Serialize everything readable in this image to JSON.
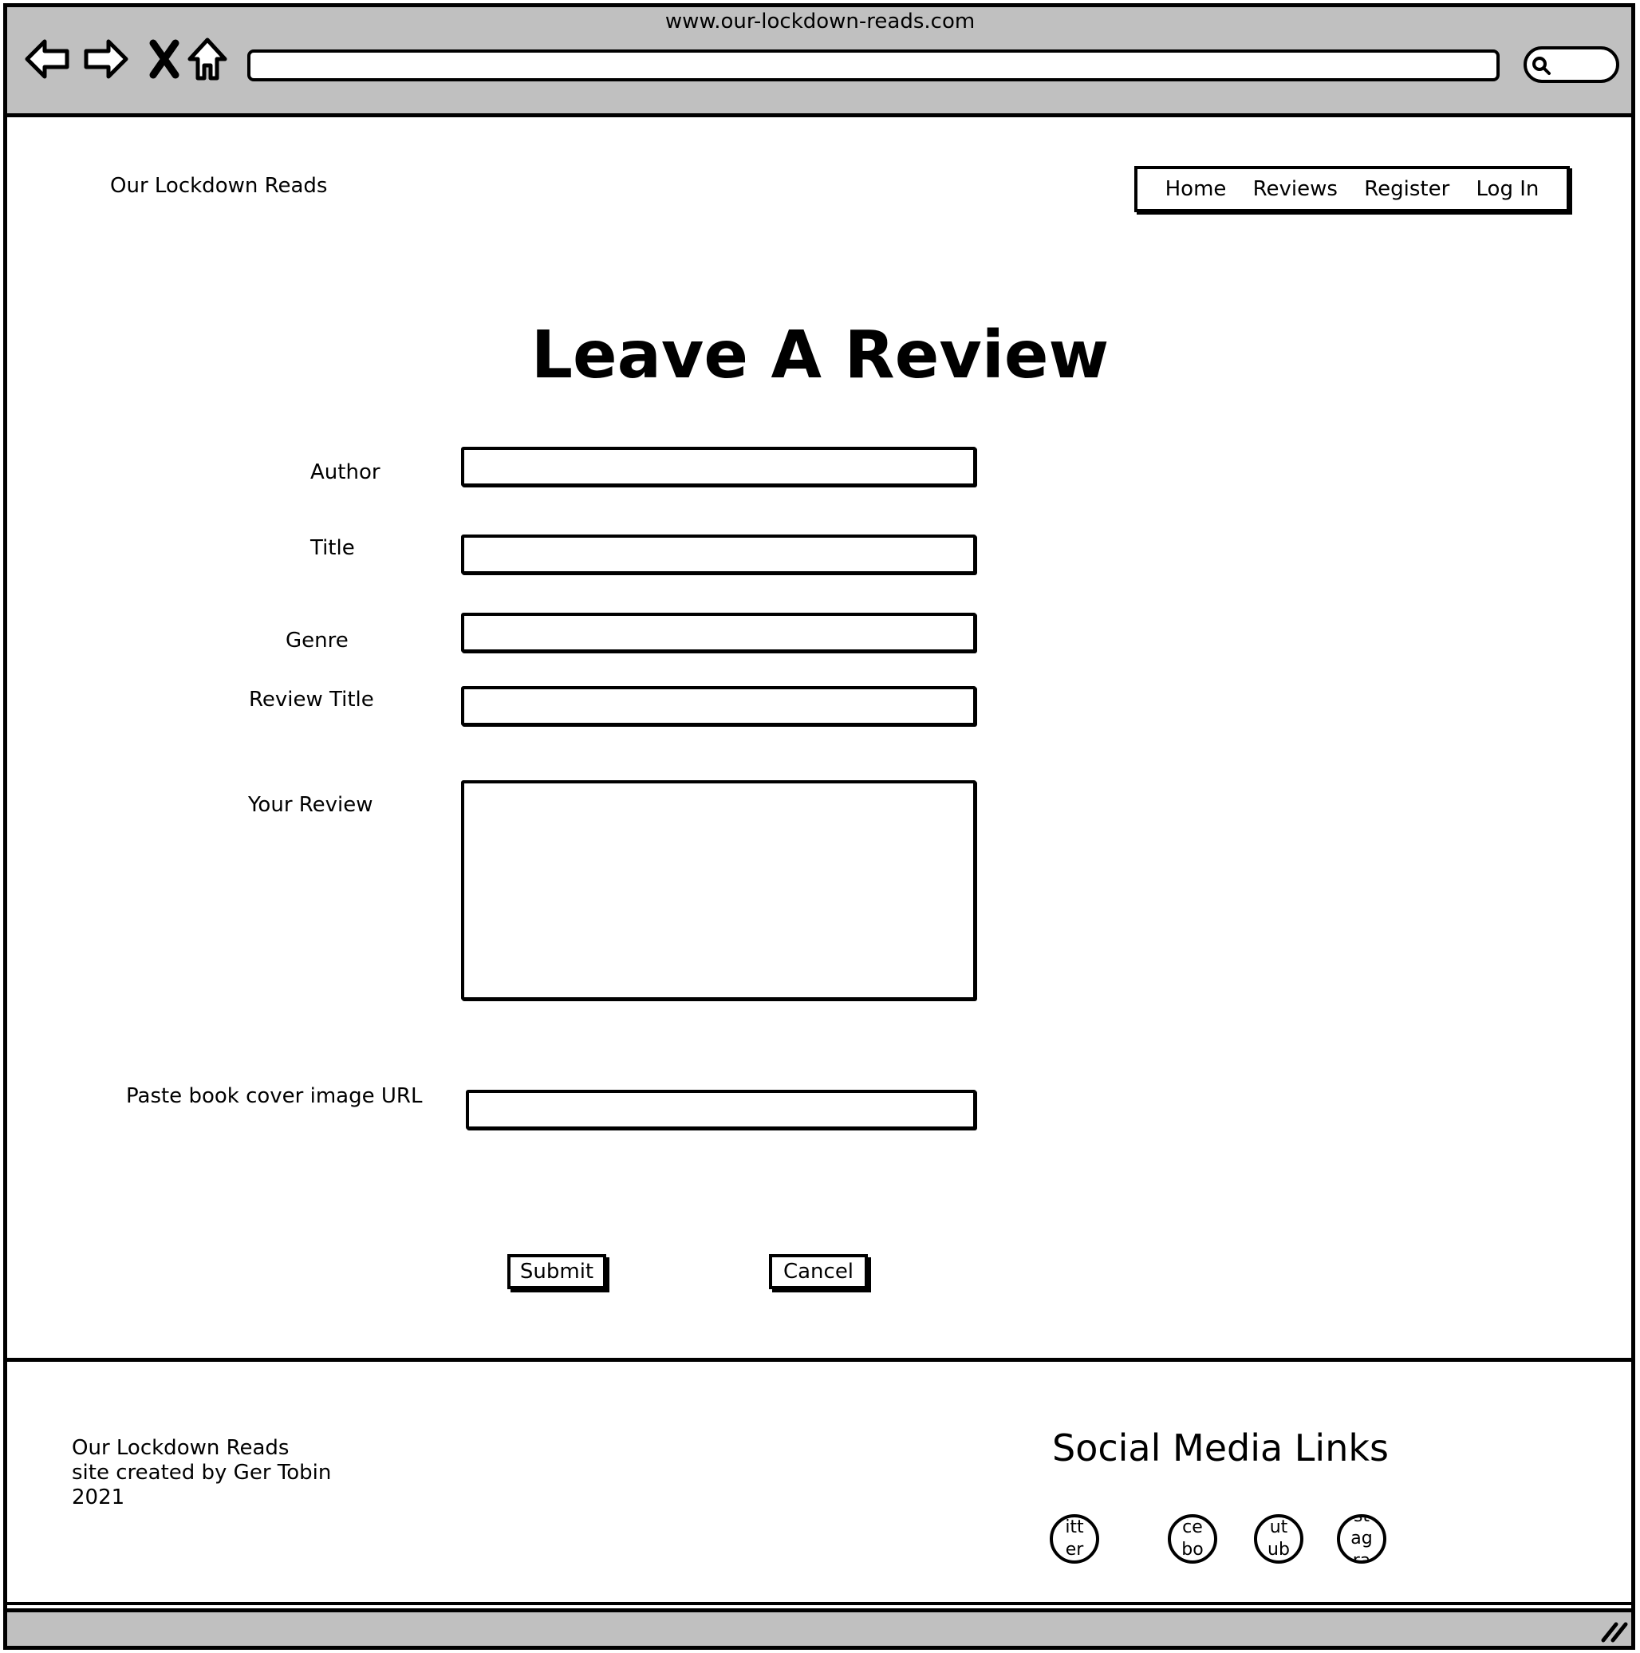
{
  "browser": {
    "url": "www.our-lockdown-reads.com",
    "icons": [
      "back-arrow-icon",
      "forward-arrow-icon",
      "stop-icon",
      "home-icon",
      "search-icon",
      "resize-grip-icon"
    ]
  },
  "header": {
    "site_name": "Our Lockdown Reads",
    "nav": [
      "Home",
      "Reviews",
      "Register",
      "Log In"
    ]
  },
  "form": {
    "title": "Leave A Review",
    "labels": {
      "author": "Author",
      "title": "Title",
      "genre": "Genre",
      "review_title": "Review Title",
      "review": "Your Review",
      "cover_url": "Paste book cover image URL"
    },
    "values": {
      "author": "",
      "title": "",
      "genre": "",
      "review_title": "",
      "review": "",
      "cover_url": ""
    },
    "submit_label": "Submit",
    "cancel_label": "Cancel"
  },
  "footer": {
    "line1": "Our Lockdown Reads",
    "line2": "site created by Ger Tobin",
    "line3": "2021",
    "social_title": "Social Media Links",
    "social_icons": [
      {
        "name": "twitter-icon",
        "text": "itt er"
      },
      {
        "name": "facebook-icon",
        "text": "ce bo"
      },
      {
        "name": "youtube-icon",
        "text": "ut ub"
      },
      {
        "name": "instagram-icon",
        "text": "st ag ra"
      }
    ]
  }
}
